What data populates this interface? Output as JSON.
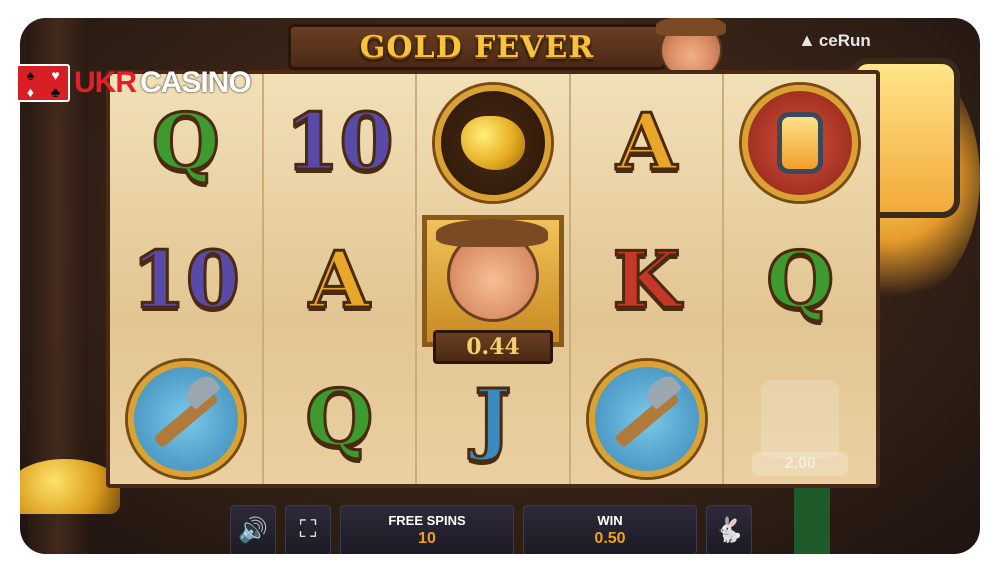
{
  "game": {
    "title": "GOLD FEVER",
    "provider": "ceRun",
    "provider_icon": "ace-triangle-logo"
  },
  "brand_overlay": {
    "part_a": "UKR",
    "part_b": "CASINO",
    "card_suits": [
      "♠",
      "♥",
      "♦",
      "♣"
    ]
  },
  "reels": [
    [
      "Q",
      "10",
      "pickaxe"
    ],
    [
      "10",
      "A",
      "Q"
    ],
    [
      "gold-nugget",
      "miner-wild",
      "J"
    ],
    [
      "A",
      "K",
      "pickaxe"
    ],
    [
      "lantern",
      "Q",
      "scroll-ghost"
    ]
  ],
  "miner_value": "0.44",
  "ghost_win_value": "2.00",
  "controls": {
    "sound_icon": "speaker-icon",
    "fullscreen_icon": "fullscreen-icon",
    "free_spins_label": "FREE SPINS",
    "free_spins_value": "10",
    "win_label": "WIN",
    "win_value": "0.50",
    "turbo_icon": "rabbit-icon"
  },
  "colors": {
    "accent": "#f0a11a",
    "title_gold": "#f7c33c",
    "brand_red": "#e2202a"
  }
}
